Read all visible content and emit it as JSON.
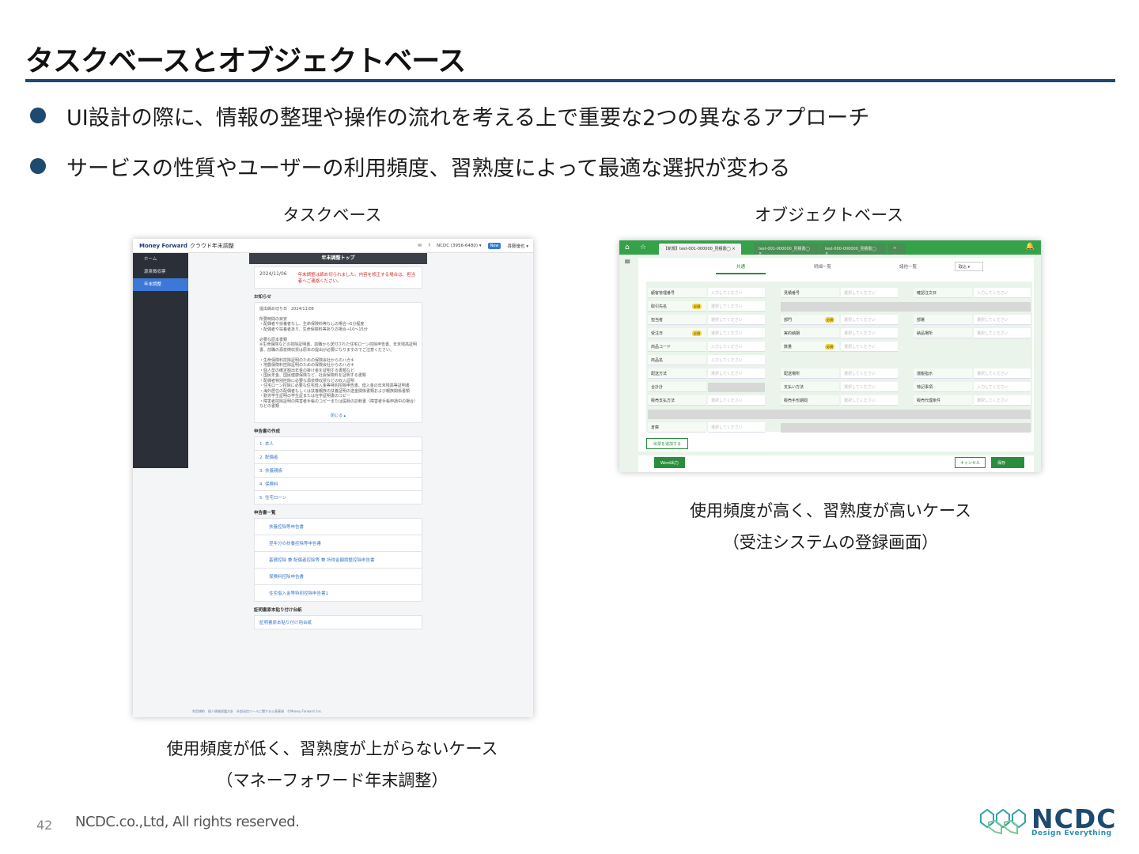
{
  "slide": {
    "title": "タスクベースとオブジェクトベース",
    "bullets": [
      "UI設計の際に、情報の整理や操作の流れを考える上で重要な2つの異なるアプローチ",
      "サービスの性質やユーザーの利用頻度、習熟度によって最適な選択が変わる"
    ],
    "left_label": "タスクベース",
    "right_label": "オブジェクトベース",
    "left_caption_1": "使用頻度が低く、習熟度が上がらないケース",
    "left_caption_2": "（マネーフォワード年末調整）",
    "right_caption_1": "使用頻度が高く、習熟度が高いケース",
    "right_caption_2": "（受注システムの登録画面）",
    "page_number": "42",
    "copyright": "NCDC.co.,Ltd, All rights reserved.",
    "logo_text": "NCDC",
    "logo_sub": "Design Everything"
  },
  "task_shot": {
    "brand": "Money Forward",
    "brand_sub": "クラウド年末調整",
    "company": "NCDC (3956-6480) ▾",
    "user_badge": "New",
    "user": "喜藤優也 ▾",
    "side_items": [
      "ホーム",
      "源泉徴収票",
      "年末調整"
    ],
    "header": "年末調整トップ",
    "date": "2024/11/06",
    "alert": "年末調整は締め切られました。内容を修正する場合は、担当者へご連絡ください。",
    "notice_title": "お知らせ",
    "deadline": "提出締め切り日　2024/11/06",
    "notice_lines": [
      "所要時間の目安",
      "・配偶者や扶養者なし、生命保険料等なしの場合→5分程度",
      "・配偶者や扶養者あり、生命保険料等ありの場合→10〜15分",
      "",
      "必要な原本書類",
      "※生命保険などの控除証明書、前職から送付された住宅ローン控除申告書、年末残高証明書、前職の源泉徴収票は原本の提出が必要になりますのでご注意ください。",
      "",
      "・生命保険料控除証明のための保険会社からのハガキ",
      "・地震保険料控除証明のための保険会社からのハガキ",
      "・個人型の確定拠出年金の掛け金を証明する書類など",
      "・国民年金、国民健康保険など、社会保険料を証明する書類",
      "・配偶者特別控除に必要な源泉徴収票などの収入証明",
      "・住宅ローン控除に必要な住宅借入金等特別控除申告書、借入金の年末残高等証明書",
      "・海外居住の配偶者もしくは扶養親族の扶養証明の送金関係書類および親族関係書類",
      "・勤労学生証明の学生証または在学証明書のコピー",
      "・障害者控除証明の障害者手帳のコピーまたは医師の診断書（障害者手帳申請中の場合）",
      "などの書類"
    ],
    "close": "閉じる ▴",
    "create_title": "申告書の作成",
    "create_items": [
      "1. 本人",
      "2. 配偶者",
      "3. 扶養親族",
      "4. 保険料",
      "5. 住宅ローン"
    ],
    "list_title": "申告書一覧",
    "list_items": [
      "扶養控除等申告書",
      "翌年分の扶養控除等申告書",
      "基礎控除 兼 配偶者控除等 兼 所得金額調整控除申告書",
      "保険料控除申告書",
      "住宅借入金等特別控除申告書1"
    ],
    "paste_title": "証明書原本貼り付け台紙",
    "paste_item": "証明書原本貼り付け用台紙",
    "footer": "利用規約　個人情報保護方針　外部送信ツールに関する公表事項　©Money Forward, Inc."
  },
  "object_shot": {
    "tabs": [
      "【新規】test-001-000000_見積書◯ ×",
      "test-001-000000_見積書◯ ×",
      "test-000-000000_見積書◯ ×",
      "+"
    ],
    "subtabs": [
      "共通",
      "明細一覧",
      "諸他一覧"
    ],
    "select": "取込 ▾",
    "placeholder": "入力してください",
    "select_placeholder": "選択してください",
    "required": "必須",
    "fields": {
      "r1": [
        "顧客管理番号",
        "見積番号",
        "確認注文日"
      ],
      "r2": [
        "取引先名"
      ],
      "r3": [
        "担当者",
        "部門",
        "部署"
      ],
      "r4": [
        "受注日",
        "実的納期",
        "納品場所"
      ],
      "r5": [
        "商品コード",
        "数量"
      ],
      "r6": [
        "商品名"
      ],
      "r7": [
        "配送方法",
        "配送場所",
        "運搬指示"
      ],
      "r8": [
        "合計計",
        "支払い方法",
        "特記事項"
      ],
      "r9": [
        "販売支払方法",
        "販売手形期間",
        "販売代理条件"
      ],
      "r10": [
        "倉庫"
      ]
    },
    "add_detail": "伝票を追加する",
    "word_button": "Word出力",
    "cancel_button": "キャンセル",
    "save_button": "保存"
  }
}
